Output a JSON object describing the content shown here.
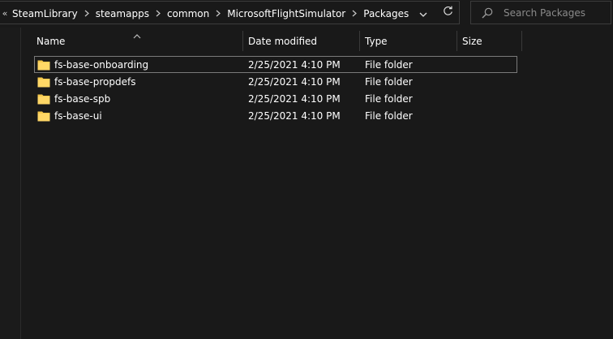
{
  "address_bar": {
    "breadcrumbs": [
      {
        "label": "SteamLibrary"
      },
      {
        "label": "steamapps"
      },
      {
        "label": "common"
      },
      {
        "label": "MicrosoftFlightSimulator"
      },
      {
        "label": "Packages"
      }
    ]
  },
  "search": {
    "placeholder": "Search Packages",
    "value": ""
  },
  "columns": {
    "name": "Name",
    "date_modified": "Date modified",
    "type": "Type",
    "size": "Size"
  },
  "files": [
    {
      "name": "fs-base-onboarding",
      "date_modified": "2/25/2021 4:10 PM",
      "type": "File folder",
      "size": ""
    },
    {
      "name": "fs-base-propdefs",
      "date_modified": "2/25/2021 4:10 PM",
      "type": "File folder",
      "size": ""
    },
    {
      "name": "fs-base-spb",
      "date_modified": "2/25/2021 4:10 PM",
      "type": "File folder",
      "size": ""
    },
    {
      "name": "fs-base-ui",
      "date_modified": "2/25/2021 4:10 PM",
      "type": "File folder",
      "size": ""
    }
  ],
  "colors": {
    "background": "#191919",
    "folder": "#f5c84c",
    "border": "#3c3c3c"
  }
}
